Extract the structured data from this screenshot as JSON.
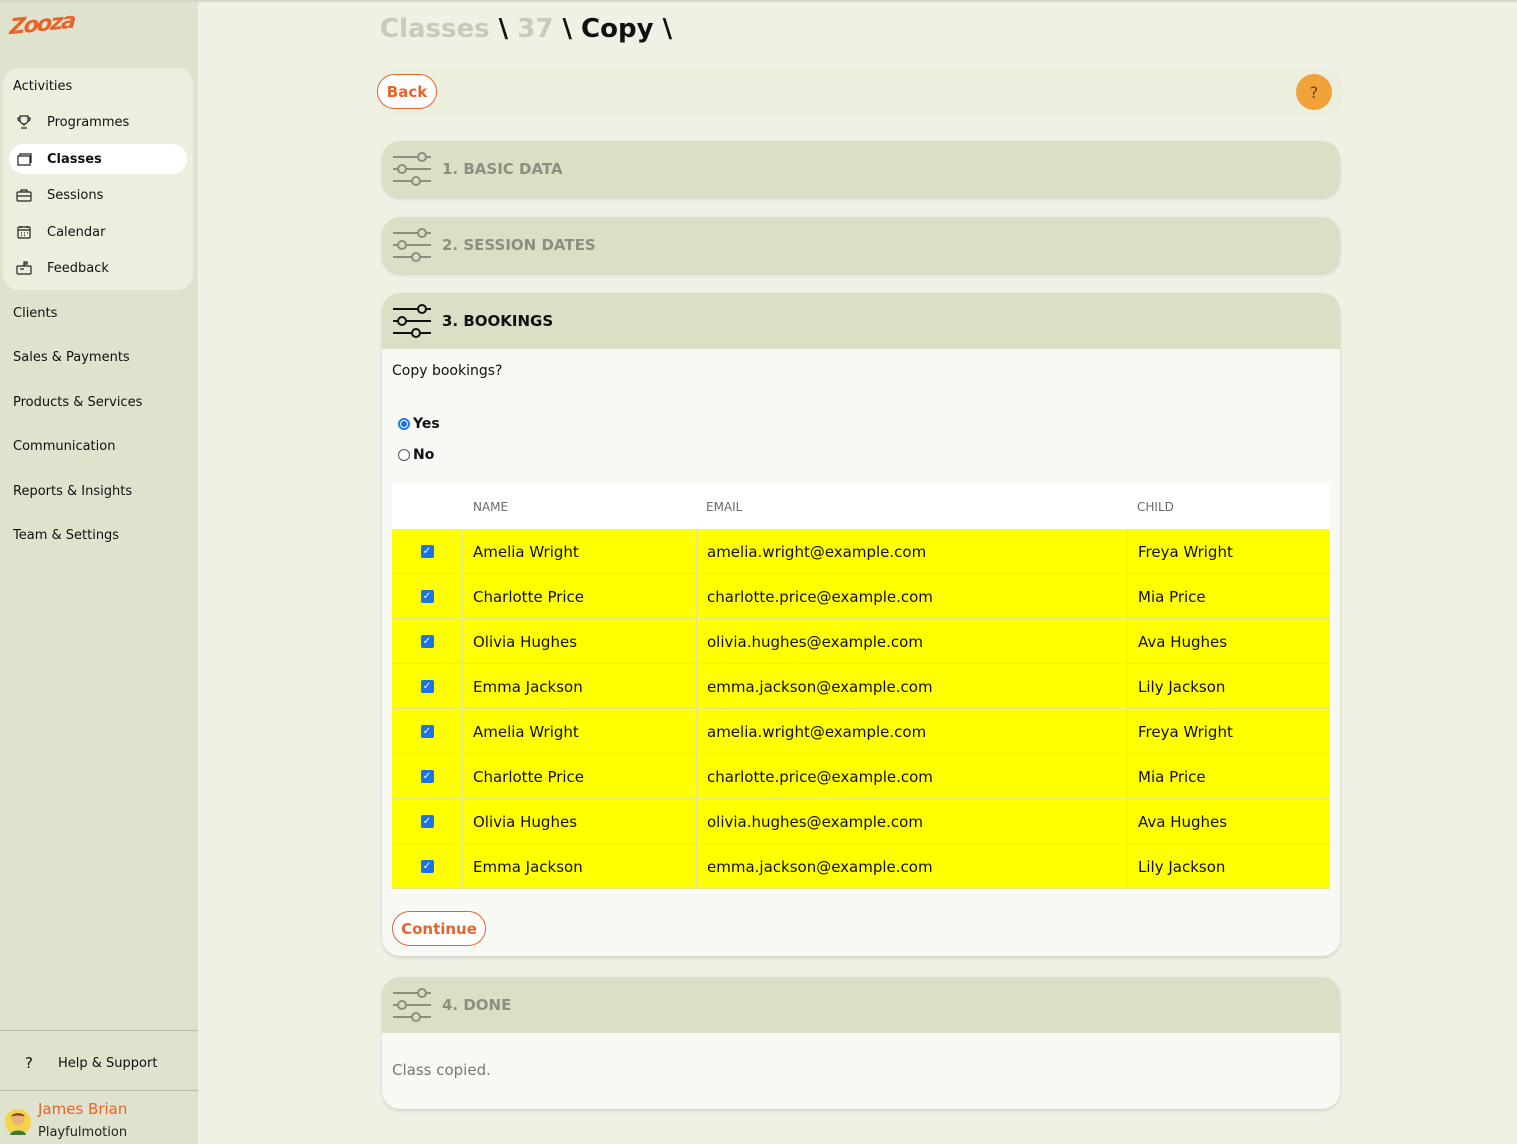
{
  "brand": {
    "logo_text": "Zooza",
    "accent": "#e8632a"
  },
  "sidebar": {
    "activities_title": "Activities",
    "activities": [
      {
        "label": "Programmes",
        "icon": "trophy-icon"
      },
      {
        "label": "Classes",
        "icon": "folder-icon",
        "active": true
      },
      {
        "label": "Sessions",
        "icon": "briefcase-icon"
      },
      {
        "label": "Calendar",
        "icon": "calendar-icon"
      },
      {
        "label": "Feedback",
        "icon": "mailbox-icon"
      }
    ],
    "links": [
      "Clients",
      "Sales & Payments",
      "Products & Services",
      "Communication",
      "Reports & Insights",
      "Team & Settings"
    ],
    "help_label": "Help & Support",
    "user_name": "James Brian",
    "user_org": "Playfulmotion"
  },
  "breadcrumb": {
    "part1": "Classes",
    "sep": "\\",
    "part2": "37",
    "current": "Copy"
  },
  "toolbar": {
    "back_label": "Back",
    "help_label": "?"
  },
  "sections": [
    {
      "label": "1. BASIC DATA"
    },
    {
      "label": "2. SESSION DATES"
    },
    {
      "label": "3. BOOKINGS"
    },
    {
      "label": "4. DONE"
    }
  ],
  "bookings": {
    "question": "Copy bookings?",
    "yes_label": "Yes",
    "no_label": "No",
    "selected": "Yes",
    "columns": [
      "NAME",
      "EMAIL",
      "CHILD"
    ],
    "rows": [
      {
        "name": "Amelia Wright",
        "email": "amelia.wright@example.com",
        "child": "Freya Wright",
        "checked": true
      },
      {
        "name": "Charlotte Price",
        "email": "charlotte.price@example.com",
        "child": "Mia Price",
        "checked": true
      },
      {
        "name": "Olivia Hughes",
        "email": "olivia.hughes@example.com",
        "child": "Ava Hughes",
        "checked": true
      },
      {
        "name": "Emma Jackson",
        "email": "emma.jackson@example.com",
        "child": "Lily Jackson",
        "checked": true
      },
      {
        "name": "Amelia Wright",
        "email": "amelia.wright@example.com",
        "child": "Freya Wright",
        "checked": true
      },
      {
        "name": "Charlotte Price",
        "email": "charlotte.price@example.com",
        "child": "Mia Price",
        "checked": true
      },
      {
        "name": "Olivia Hughes",
        "email": "olivia.hughes@example.com",
        "child": "Ava Hughes",
        "checked": true
      },
      {
        "name": "Emma Jackson",
        "email": "emma.jackson@example.com",
        "child": "Lily Jackson",
        "checked": true
      }
    ],
    "row_highlight_color": "#ffff00",
    "continue_label": "Continue"
  },
  "done": {
    "message": "Class copied."
  }
}
